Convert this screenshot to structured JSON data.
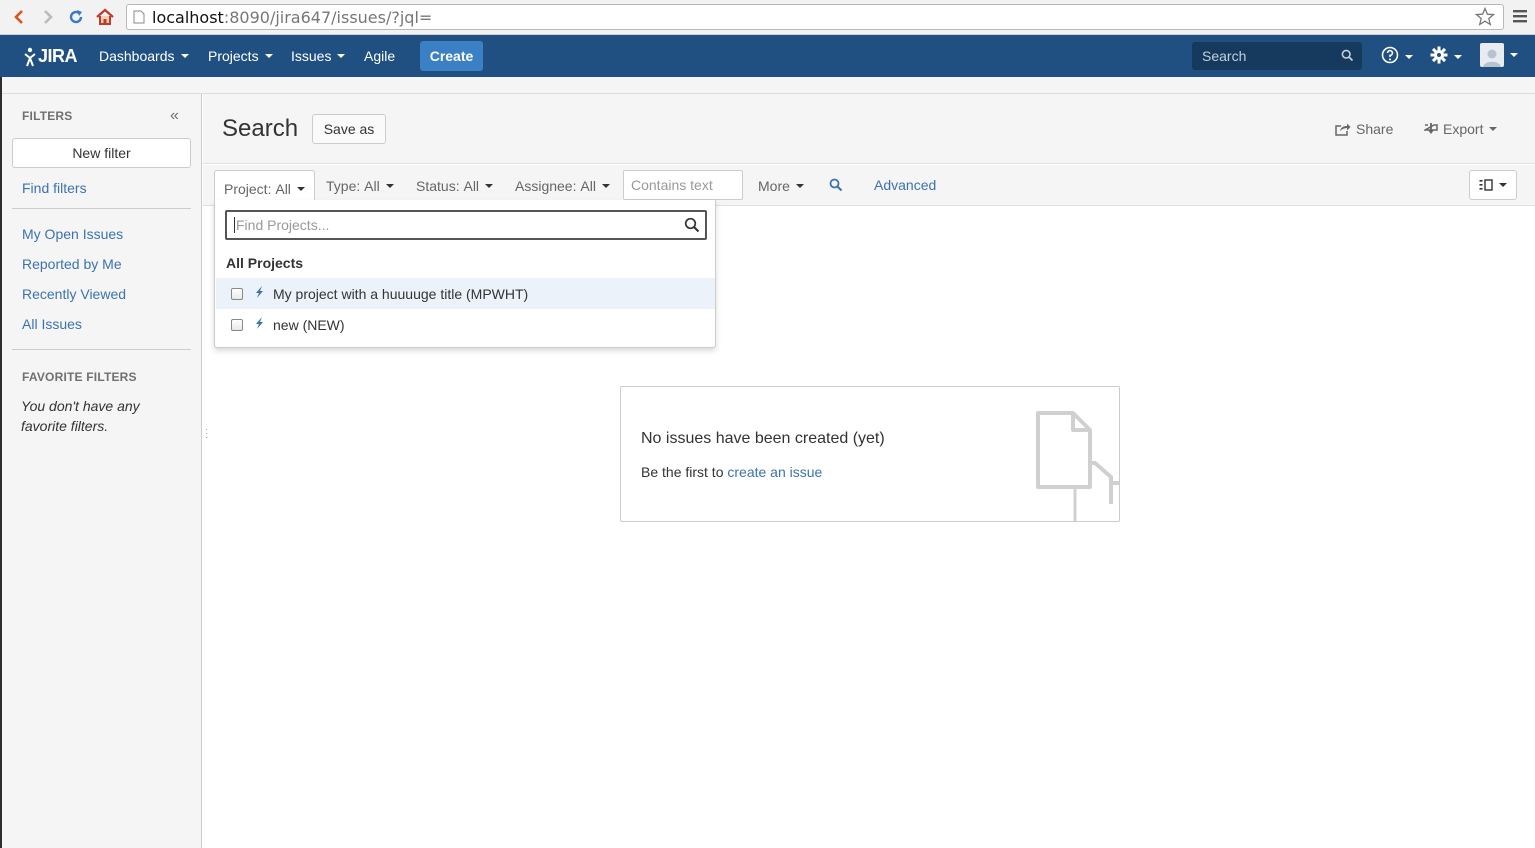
{
  "browser": {
    "url_host": "localhost",
    "url_path": ":8090/jira647/issues/?jql="
  },
  "header": {
    "logo_text": "JIRA",
    "nav": [
      {
        "label": "Dashboards"
      },
      {
        "label": "Projects"
      },
      {
        "label": "Issues"
      },
      {
        "label": "Agile"
      }
    ],
    "create_label": "Create",
    "search_placeholder": "Search",
    "brand_color": "#205081"
  },
  "sidebar": {
    "filters_heading": "FILTERS",
    "new_filter_label": "New filter",
    "find_filters_label": "Find filters",
    "items": [
      {
        "label": "My Open Issues"
      },
      {
        "label": "Reported by Me"
      },
      {
        "label": "Recently Viewed"
      },
      {
        "label": "All Issues"
      }
    ],
    "favorite_heading": "FAVORITE FILTERS",
    "favorite_empty": "You don't have any favorite filters."
  },
  "main": {
    "title": "Search",
    "save_as_label": "Save as",
    "share_label": "Share",
    "export_label": "Export"
  },
  "filter_bar": {
    "project": {
      "label": "Project:",
      "value": "All"
    },
    "type": {
      "label": "Type:",
      "value": "All"
    },
    "status": {
      "label": "Status:",
      "value": "All"
    },
    "assignee": {
      "label": "Assignee:",
      "value": "All"
    },
    "text_placeholder": "Contains text",
    "more_label": "More",
    "advanced_label": "Advanced"
  },
  "project_dropdown": {
    "search_placeholder": "Find Projects...",
    "group_label": "All Projects",
    "items": [
      {
        "label": "My project with a huuuuge title (MPWHT)",
        "checked": false
      },
      {
        "label": "new (NEW)",
        "checked": false
      }
    ]
  },
  "empty_state": {
    "title": "No issues have been created (yet)",
    "text_prefix": "Be the first to",
    "link_label": "create an issue"
  }
}
